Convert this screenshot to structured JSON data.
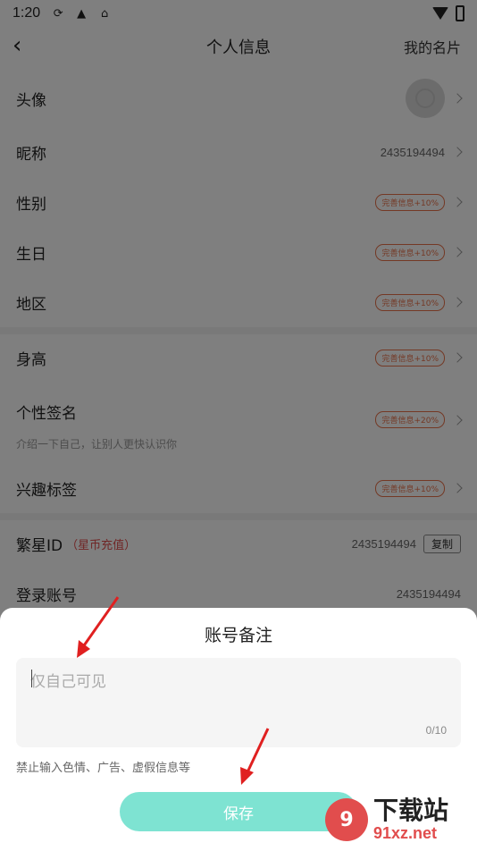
{
  "status_bar": {
    "time": "1:20"
  },
  "header": {
    "title": "个人信息",
    "right_link": "我的名片"
  },
  "rows": {
    "avatar": {
      "label": "头像"
    },
    "nickname": {
      "label": "昵称",
      "value": "2435194494"
    },
    "gender": {
      "label": "性别",
      "badge": "完善信息+10%"
    },
    "birthday": {
      "label": "生日",
      "badge": "完善信息+10%"
    },
    "region": {
      "label": "地区",
      "badge": "完善信息+10%"
    },
    "height": {
      "label": "身高",
      "badge": "完善信息+10%"
    },
    "signature": {
      "label": "个性签名",
      "sublabel": "介绍一下自己，让别人更快认识你",
      "badge": "完善信息+20%"
    },
    "interests": {
      "label": "兴趣标签",
      "badge": "完善信息+10%"
    },
    "fanxing_id": {
      "label": "繁星ID",
      "tag": "（星币充值）",
      "value": "2435194494",
      "copy": "复制"
    },
    "login_account": {
      "label": "登录账号",
      "value": "2435194494"
    }
  },
  "sheet": {
    "title": "账号备注",
    "placeholder": "仅自己可见",
    "counter": "0/10",
    "hint": "禁止输入色情、广告、虚假信息等",
    "save_label": "保存"
  },
  "watermark": {
    "main": "下载站",
    "domain": "91xz.net",
    "logo": "9"
  },
  "colors": {
    "accent": "#7ee3d2",
    "badge": "#e8724a",
    "arrow": "#e02020"
  }
}
